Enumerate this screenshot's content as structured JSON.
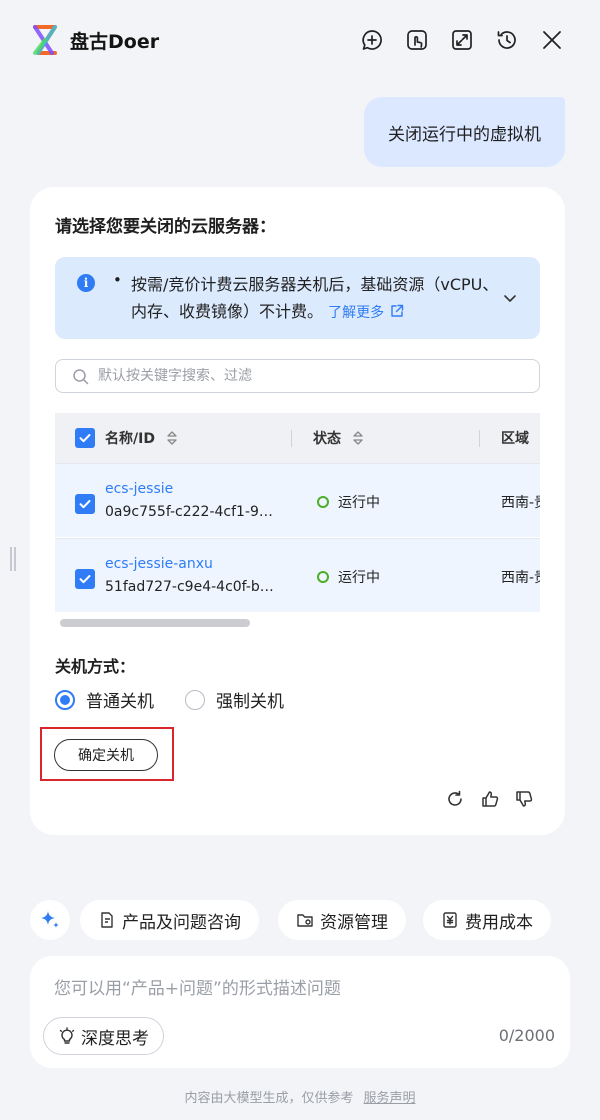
{
  "header": {
    "app_title": "盘古Doer"
  },
  "user_message": "关闭运行中的虚拟机",
  "card": {
    "title": "请选择您要关闭的云服务器：",
    "notice": {
      "text": "按需/竞价计费云服务器关机后，基础资源（vCPU、内存、收费镜像）不计费。",
      "learn_more": "了解更多"
    },
    "search_placeholder": "默认按关键字搜索、过滤",
    "table": {
      "columns": [
        "名称/ID",
        "状态",
        "区域"
      ],
      "rows": [
        {
          "name": "ecs-jessie",
          "id": "0a9c755f-c222-4cf1-9…",
          "status": "运行中",
          "region": "西南-贵"
        },
        {
          "name": "ecs-jessie-anxu",
          "id": "51fad727-c9e4-4c0f-b…",
          "status": "运行中",
          "region": "西南-贵"
        }
      ]
    },
    "shutdown_mode_label": "关机方式：",
    "modes": [
      {
        "label": "普通关机",
        "selected": true
      },
      {
        "label": "强制关机",
        "selected": false
      }
    ],
    "confirm_label": "确定关机"
  },
  "quick_actions": [
    "产品及问题咨询",
    "资源管理",
    "费用成本"
  ],
  "input": {
    "placeholder": "您可以用“产品+问题”的形式描述问题",
    "deep_think_label": "深度思考",
    "counter": "0/2000"
  },
  "footer": {
    "disclaimer": "内容由大模型生成，仅供参考",
    "link": "服务声明"
  },
  "colors": {
    "accent": "#2f7cf6",
    "status_running": "#4caf28",
    "highlight": "#d8262c",
    "user_bubble": "#dbe8ff"
  }
}
